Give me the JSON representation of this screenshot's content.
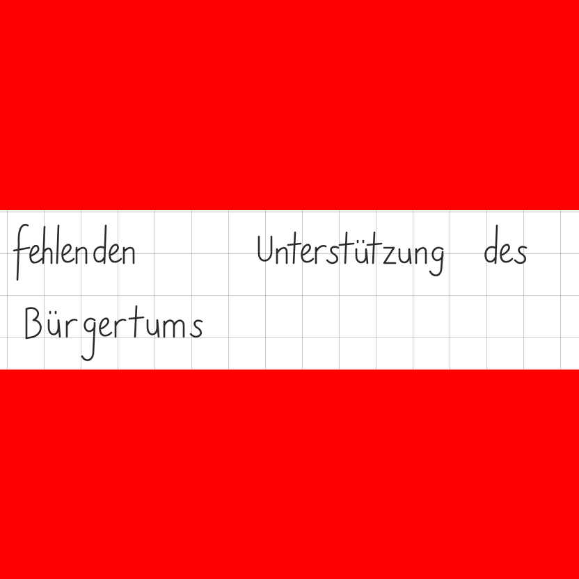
{
  "colors": {
    "band": "#ff0000",
    "paper": "#ffffff",
    "grid": "#a0a0a0",
    "ink": "#2a2a2a"
  },
  "handwriting": {
    "line1": "fehlenden Unterstützung des",
    "line2": "Bürgertums"
  }
}
